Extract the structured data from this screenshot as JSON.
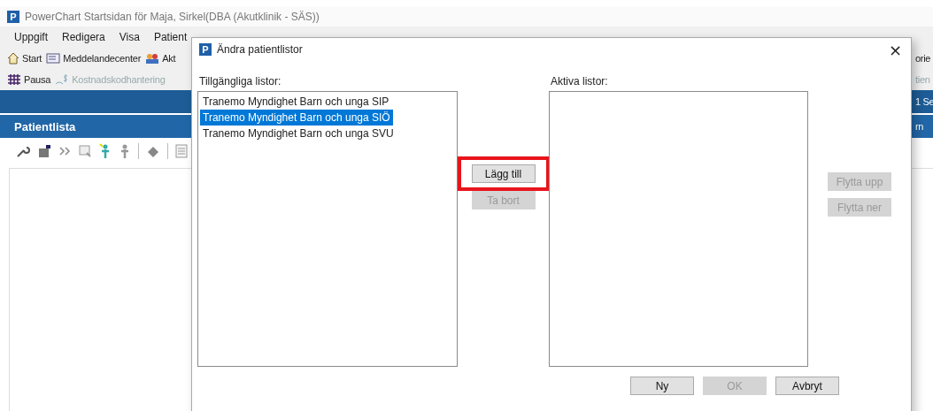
{
  "window": {
    "logo": "P",
    "title": "PowerChart Startsidan för Maja, Sirkel(DBA (Akutklinik - SÄS))"
  },
  "menu": [
    "Uppgift",
    "Redigera",
    "Visa",
    "Patient"
  ],
  "toolbar_1": [
    {
      "label": "Start",
      "kind": "home",
      "disabled": false
    },
    {
      "label": "Meddelandecenter",
      "kind": "message",
      "disabled": false
    },
    {
      "label": "Akt",
      "kind": "people",
      "disabled": false
    }
  ],
  "toolbar_2": [
    {
      "label": "Pausa",
      "kind": "pause",
      "disabled": false
    },
    {
      "label": "Kostnadskodhantering",
      "kind": "cost",
      "disabled": true
    }
  ],
  "right_edge": {
    "toolbar_1": "orie",
    "toolbar_2": "tien",
    "band": "1 Se",
    "header": "rn"
  },
  "panel": {
    "title": "Patientlista"
  },
  "dialog": {
    "logo": "P",
    "title": "Ändra patientlistor",
    "close": "×",
    "available": {
      "label": "Tillgängliga listor:",
      "items": [
        {
          "label": "Tranemo Myndighet Barn och unga SIP",
          "selected": false
        },
        {
          "label": "Tranemo Myndighet Barn och unga SIÖ",
          "selected": true
        },
        {
          "label": "Tranemo Myndighet Barn och unga SVU",
          "selected": false
        }
      ]
    },
    "middle_buttons": [
      {
        "label": "Lägg till",
        "disabled": false,
        "highlighted": true
      },
      {
        "label": "Ta bort",
        "disabled": true,
        "highlighted": false
      }
    ],
    "active": {
      "label": "Aktiva listor:"
    },
    "side_buttons": [
      {
        "label": "Flytta upp",
        "disabled": true
      },
      {
        "label": "Flytta ner",
        "disabled": true
      }
    ],
    "footer_buttons": [
      {
        "label": "Ny",
        "disabled": false
      },
      {
        "label": "OK",
        "disabled": true
      },
      {
        "label": "Avbryt",
        "disabled": false
      }
    ]
  }
}
